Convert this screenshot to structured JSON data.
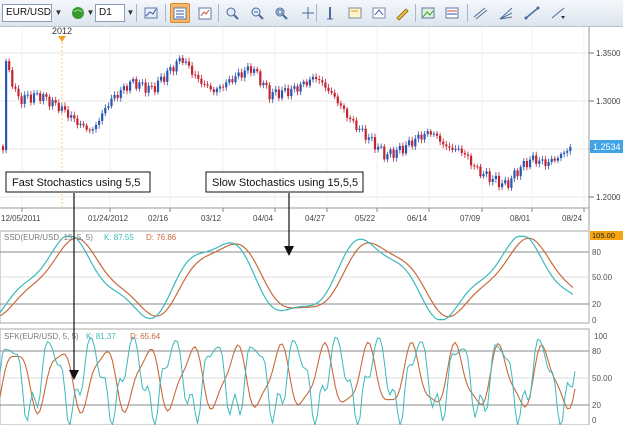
{
  "toolbar": {
    "symbol": "EUR/USD",
    "timeframe": "D1",
    "buttons": [
      {
        "name": "globe-button",
        "icon": "globe-icon"
      },
      {
        "name": "chart-type-button",
        "icon": "chart-icon"
      },
      {
        "name": "indicators-button",
        "icon": "indicator-icon",
        "active": true
      },
      {
        "name": "templates-button",
        "icon": "template-icon"
      },
      {
        "name": "zoom-in-button",
        "icon": "zoom-in-icon"
      },
      {
        "name": "zoom-out-button",
        "icon": "zoom-out-icon"
      },
      {
        "name": "zoom-fit-button",
        "icon": "zoom-fit-icon"
      },
      {
        "name": "crosshair-button",
        "icon": "crosshair-icon"
      },
      {
        "name": "vertical-line-button",
        "icon": "vertical-line-icon"
      },
      {
        "name": "note-button",
        "icon": "note-icon"
      },
      {
        "name": "alert-button",
        "icon": "alert-icon"
      },
      {
        "name": "pencil-button",
        "icon": "pencil-icon"
      },
      {
        "name": "image-button",
        "icon": "image-icon"
      },
      {
        "name": "fibonacci-button",
        "icon": "fibonacci-icon"
      },
      {
        "name": "channel-button",
        "icon": "channel-icon"
      },
      {
        "name": "fan-button",
        "icon": "fan-icon"
      },
      {
        "name": "trend-line-button",
        "icon": "trend-line-icon"
      },
      {
        "name": "more-button",
        "icon": "more-icon"
      }
    ]
  },
  "chart": {
    "year_marker": "2012",
    "current_price": "1.2534",
    "price_ticks": [
      "1.3500",
      "1.3000",
      "1.2500",
      "1.2000"
    ],
    "date_ticks": [
      "12/05/2011",
      "01/24/2012",
      "02/16",
      "03/12",
      "04/04",
      "04/27",
      "05/22",
      "06/14",
      "07/09",
      "08/01",
      "08/24"
    ],
    "colors": {
      "up": "#2956b2",
      "down": "#c4232f",
      "k_line": "#3cb9bb",
      "d_line": "#c86a3c",
      "price_label_bg": "#3fa3e6"
    }
  },
  "panes": {
    "ssd": {
      "label": "SSD(EUR/USD, 15, 5, 5)",
      "k_label": "K: 87.55",
      "d_label": "D: 76.86",
      "top_value": "105.00",
      "mid_value": "50.00",
      "ticks": [
        "80",
        "50.00",
        "20",
        "0"
      ]
    },
    "sfk": {
      "label": "SFK(EUR/USD, 5, 5)",
      "k_label": "K: 81.37",
      "d_label": "D: 65.64",
      "top_value": "100",
      "ticks": [
        "80",
        "50.00",
        "20",
        "0"
      ]
    }
  },
  "annotations": {
    "fast": "Fast Stochastics using 5,5",
    "slow": "Slow Stochastics using 15,5,5"
  }
}
